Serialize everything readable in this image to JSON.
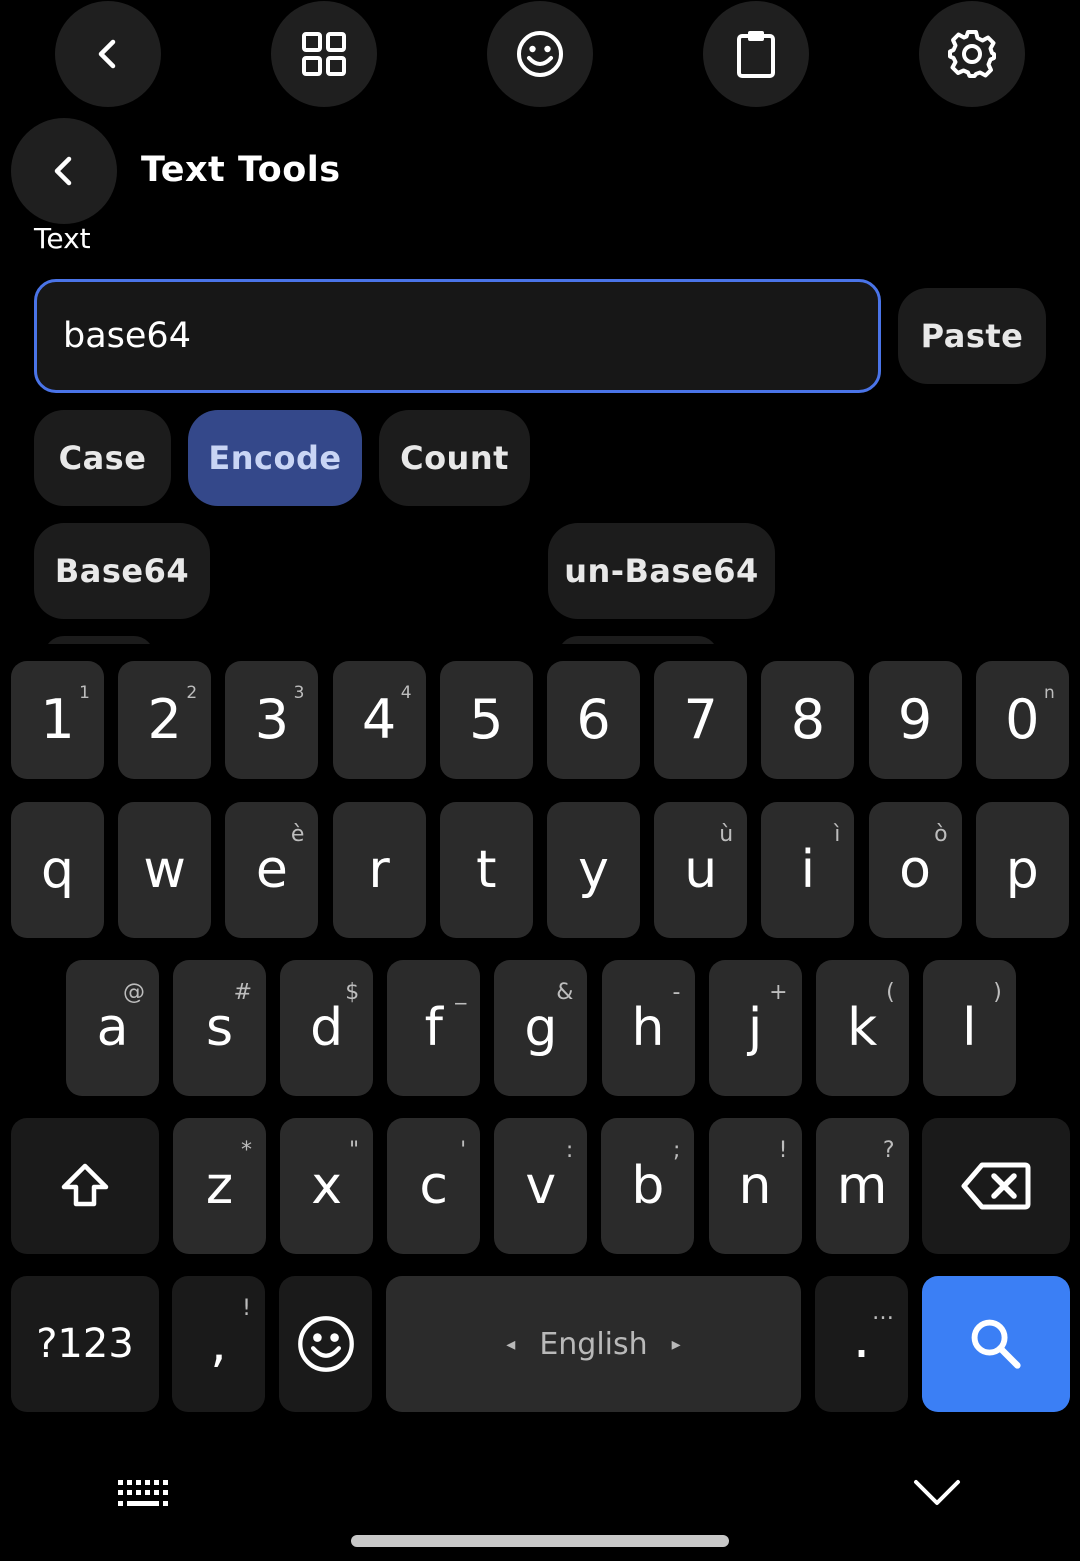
{
  "toolbar": {
    "icons": [
      "back-arrow-icon",
      "grid-icon",
      "emoji-icon",
      "clipboard-icon",
      "gear-icon"
    ]
  },
  "header": {
    "title": "Text Tools"
  },
  "input": {
    "label": "Text",
    "value": "base64",
    "paste_label": "Paste"
  },
  "tabs": [
    {
      "label": "Case",
      "active": false
    },
    {
      "label": "Encode",
      "active": true
    },
    {
      "label": "Count",
      "active": false
    }
  ],
  "actions": [
    {
      "label": "Base64"
    },
    {
      "label": "un-Base64"
    }
  ],
  "keyboard": {
    "number_row": [
      {
        "key": "1",
        "hint": "1"
      },
      {
        "key": "2",
        "hint": "2"
      },
      {
        "key": "3",
        "hint": "3"
      },
      {
        "key": "4",
        "hint": "4"
      },
      {
        "key": "5",
        "hint": ""
      },
      {
        "key": "6",
        "hint": ""
      },
      {
        "key": "7",
        "hint": ""
      },
      {
        "key": "8",
        "hint": ""
      },
      {
        "key": "9",
        "hint": ""
      },
      {
        "key": "0",
        "hint": "n"
      }
    ],
    "row1": [
      {
        "key": "q",
        "hint": ""
      },
      {
        "key": "w",
        "hint": ""
      },
      {
        "key": "e",
        "hint": "è"
      },
      {
        "key": "r",
        "hint": ""
      },
      {
        "key": "t",
        "hint": ""
      },
      {
        "key": "y",
        "hint": ""
      },
      {
        "key": "u",
        "hint": "ù"
      },
      {
        "key": "i",
        "hint": "ì"
      },
      {
        "key": "o",
        "hint": "ò"
      },
      {
        "key": "p",
        "hint": ""
      }
    ],
    "row2": [
      {
        "key": "a",
        "hint": "@"
      },
      {
        "key": "s",
        "hint": "#"
      },
      {
        "key": "d",
        "hint": "$"
      },
      {
        "key": "f",
        "hint": "_"
      },
      {
        "key": "g",
        "hint": "&"
      },
      {
        "key": "h",
        "hint": "-"
      },
      {
        "key": "j",
        "hint": "+"
      },
      {
        "key": "k",
        "hint": "("
      },
      {
        "key": "l",
        "hint": ")"
      }
    ],
    "row3": [
      {
        "key": "z",
        "hint": "*"
      },
      {
        "key": "x",
        "hint": "\""
      },
      {
        "key": "c",
        "hint": "'"
      },
      {
        "key": "v",
        "hint": ":"
      },
      {
        "key": "b",
        "hint": ";"
      },
      {
        "key": "n",
        "hint": "!"
      },
      {
        "key": "m",
        "hint": "?"
      }
    ],
    "symbols_label": "?123",
    "comma": {
      "key": ",",
      "hint": "!"
    },
    "space_label": "English",
    "space_left": "◂",
    "space_right": "▸",
    "period": {
      "key": ".",
      "hint": "…"
    }
  },
  "nav": {
    "icons": [
      "keyboard-icon",
      "chevron-down-icon"
    ]
  },
  "colors": {
    "accent": "#3b7ff5",
    "active_tab": "#34488a",
    "input_border": "#4a74e8"
  }
}
